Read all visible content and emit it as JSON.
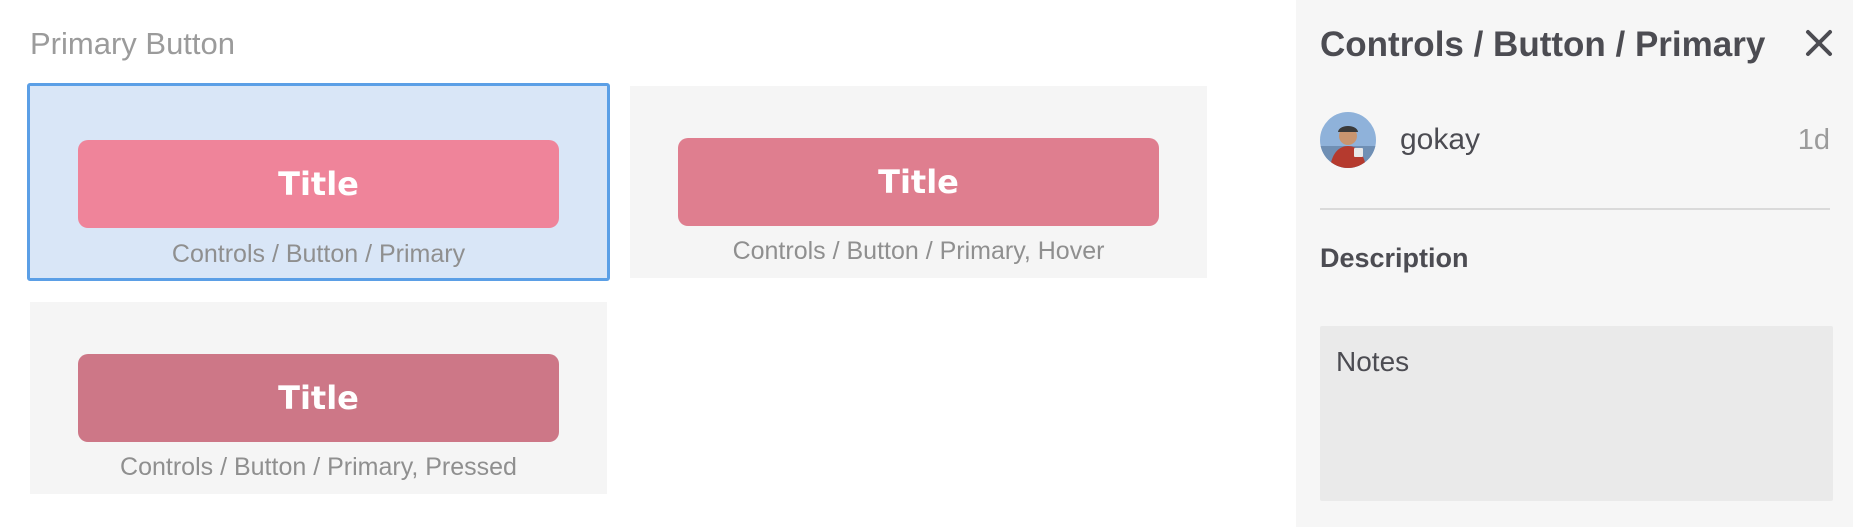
{
  "canvas": {
    "section_title": "Primary Button",
    "variants": [
      {
        "button_label": "Title",
        "name": "Controls / Button / Primary",
        "button_color": "#ef849a",
        "selected": true
      },
      {
        "button_label": "Title",
        "name": "Controls / Button / Primary, Hover",
        "button_color": "#df7e8f",
        "selected": false
      },
      {
        "button_label": "Title",
        "name": "Controls / Button / Primary, Pressed",
        "button_color": "#cd7787",
        "selected": false
      }
    ],
    "selection_color": "#5b9fe6"
  },
  "panel": {
    "title": "Controls / Button / Primary",
    "close_icon": "close-icon",
    "author": {
      "avatar_icon": "user-avatar",
      "name": "gokay",
      "age": "1d"
    },
    "description_label": "Description",
    "notes_placeholder": "Notes"
  }
}
